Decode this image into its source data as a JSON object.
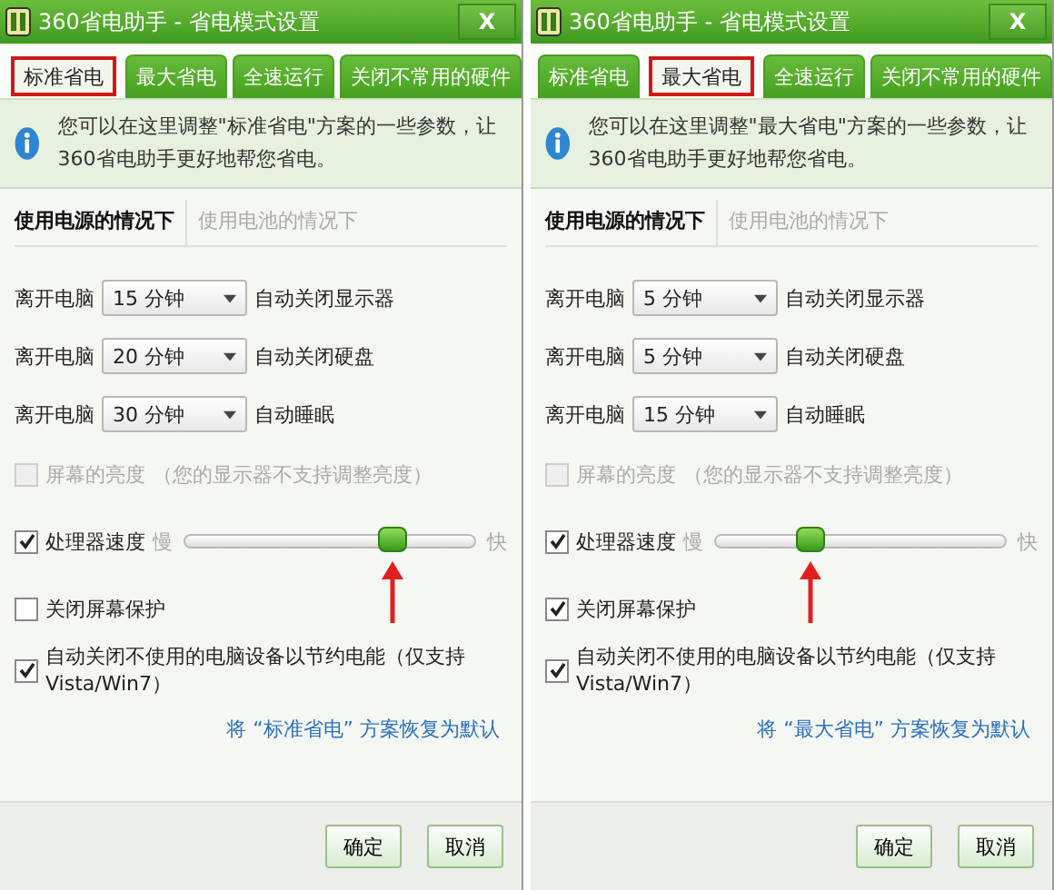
{
  "windows": [
    {
      "title": "360省电助手 - 省电模式设置",
      "close": "X",
      "tabs": [
        {
          "label": "标准省电",
          "selected": true
        },
        {
          "label": "最大省电",
          "selected": false
        },
        {
          "label": "全速运行",
          "selected": false
        },
        {
          "label": "关闭不常用的硬件",
          "selected": false
        }
      ],
      "info": "您可以在这里调整\"标准省电\"方案的一些参数，让360省电助手更好地帮您省电。",
      "subtabs": [
        {
          "label": "使用电源的情况下",
          "selected": true
        },
        {
          "label": "使用电池的情况下",
          "selected": false
        }
      ],
      "timers": [
        {
          "label": "离开电脑",
          "value": "15 分钟",
          "action": "自动关闭显示器"
        },
        {
          "label": "离开电脑",
          "value": "20 分钟",
          "action": "自动关闭硬盘"
        },
        {
          "label": "离开电脑",
          "value": "30 分钟",
          "action": "自动睡眠"
        }
      ],
      "options": [
        {
          "kind": "checkbox",
          "label": "屏幕的亮度",
          "note": "（您的显示器不支持调整亮度）",
          "checked": false,
          "disabled": true
        },
        {
          "kind": "slider",
          "label": "处理器速度",
          "checked": true,
          "disabled": false,
          "min_label": "慢",
          "max_label": "快",
          "level": 0.72
        },
        {
          "kind": "checkbox",
          "label": "关闭屏幕保护",
          "checked": false,
          "disabled": false
        },
        {
          "kind": "checkbox",
          "label": "自动关闭不使用的电脑设备以节约电能（仅支持Vista/Win7）",
          "checked": true,
          "disabled": false
        }
      ],
      "restore_link": "将 “标准省电” 方案恢复为默认",
      "buttons": [
        "确定",
        "取消"
      ]
    },
    {
      "title": "360省电助手 - 省电模式设置",
      "close": "X",
      "tabs": [
        {
          "label": "标准省电",
          "selected": false
        },
        {
          "label": "最大省电",
          "selected": true
        },
        {
          "label": "全速运行",
          "selected": false
        },
        {
          "label": "关闭不常用的硬件",
          "selected": false
        }
      ],
      "info": "您可以在这里调整\"最大省电\"方案的一些参数，让360省电助手更好地帮您省电。",
      "subtabs": [
        {
          "label": "使用电源的情况下",
          "selected": true
        },
        {
          "label": "使用电池的情况下",
          "selected": false
        }
      ],
      "timers": [
        {
          "label": "离开电脑",
          "value": "5 分钟",
          "action": "自动关闭显示器"
        },
        {
          "label": "离开电脑",
          "value": "5 分钟",
          "action": "自动关闭硬盘"
        },
        {
          "label": "离开电脑",
          "value": "15 分钟",
          "action": "自动睡眠"
        }
      ],
      "options": [
        {
          "kind": "checkbox",
          "label": "屏幕的亮度",
          "note": "（您的显示器不支持调整亮度）",
          "checked": false,
          "disabled": true
        },
        {
          "kind": "slider",
          "label": "处理器速度",
          "checked": true,
          "disabled": false,
          "min_label": "慢",
          "max_label": "快",
          "level": 0.33
        },
        {
          "kind": "checkbox",
          "label": "关闭屏幕保护",
          "checked": true,
          "disabled": false
        },
        {
          "kind": "checkbox",
          "label": "自动关闭不使用的电脑设备以节约电能（仅支持Vista/Win7）",
          "checked": true,
          "disabled": false
        }
      ],
      "restore_link": "将 “最大省电” 方案恢复为默认",
      "buttons": [
        "确定",
        "取消"
      ]
    }
  ]
}
